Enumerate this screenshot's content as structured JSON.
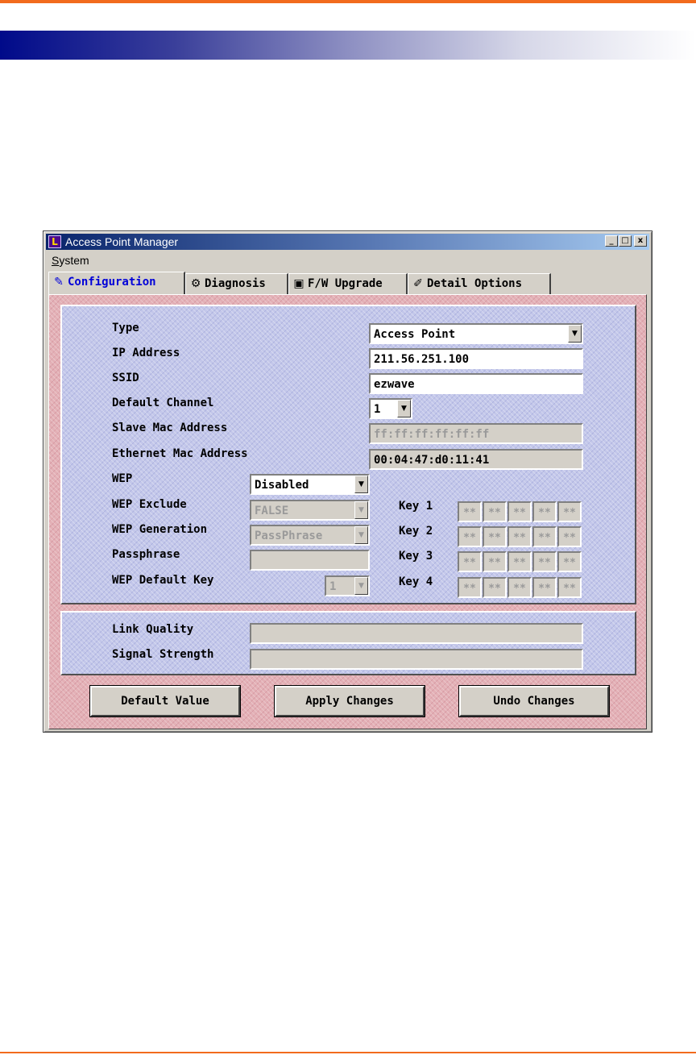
{
  "window": {
    "title": "Access Point Manager",
    "controls": {
      "minimize": "_",
      "maximize": "□",
      "close": "x"
    }
  },
  "menu": {
    "system": {
      "accel": "S",
      "rest": "ystem"
    }
  },
  "tabs": [
    {
      "label": "Configuration",
      "icon": "wrench-icon",
      "glyph": "✎",
      "active": true
    },
    {
      "label": "Diagnosis",
      "icon": "stethoscope-icon",
      "glyph": "⚙"
    },
    {
      "label": "F/W Upgrade",
      "icon": "monitor-icon",
      "glyph": "▣"
    },
    {
      "label": "Detail Options",
      "icon": "pencil-icon",
      "glyph": "✐"
    }
  ],
  "config": {
    "type": {
      "label": "Type",
      "value": "Access Point"
    },
    "ip": {
      "label": "IP Address",
      "value": "211.56.251.100"
    },
    "ssid": {
      "label": "SSID",
      "value": "ezwave"
    },
    "channel": {
      "label": "Default Channel",
      "value": "1"
    },
    "slave_mac": {
      "label": "Slave Mac Address",
      "value": "ff:ff:ff:ff:ff:ff"
    },
    "eth_mac": {
      "label": "Ethernet Mac Address",
      "value": "00:04:47:d0:11:41"
    },
    "wep": {
      "label": "WEP",
      "value": "Disabled"
    },
    "wep_exclude": {
      "label": "WEP Exclude",
      "value": "FALSE"
    },
    "wep_generation": {
      "label": "WEP Generation",
      "value": "PassPhrase"
    },
    "passphrase": {
      "label": "Passphrase",
      "value": ""
    },
    "wep_default_key": {
      "label": "WEP Default Key",
      "value": "1"
    },
    "keys": [
      {
        "label": "Key 1",
        "cells": [
          "**",
          "**",
          "**",
          "**",
          "**"
        ]
      },
      {
        "label": "Key 2",
        "cells": [
          "**",
          "**",
          "**",
          "**",
          "**"
        ]
      },
      {
        "label": "Key 3",
        "cells": [
          "**",
          "**",
          "**",
          "**",
          "**"
        ]
      },
      {
        "label": "Key 4",
        "cells": [
          "**",
          "**",
          "**",
          "**",
          "**"
        ]
      }
    ]
  },
  "status": {
    "link_quality": {
      "label": "Link Quality",
      "value": ""
    },
    "signal_strength": {
      "label": "Signal Strength",
      "value": ""
    }
  },
  "buttons": {
    "default": "Default Value",
    "apply": "Apply Changes",
    "undo": "Undo Changes"
  }
}
